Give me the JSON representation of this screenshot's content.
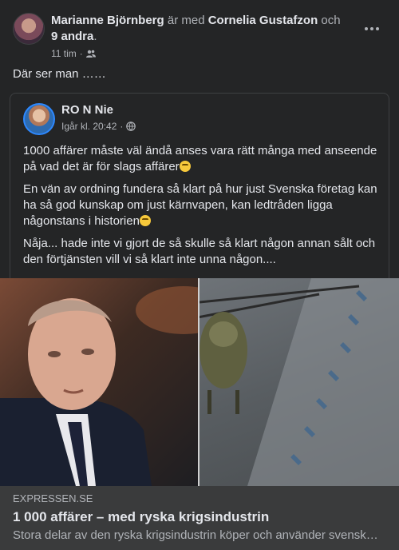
{
  "post": {
    "author": "Marianne Björnberg",
    "with_text": "är med",
    "tagged": "Cornelia Gustafzon",
    "and_text": "och",
    "others": "9 andra",
    "period": ".",
    "time": "11 tim",
    "dot": "·",
    "audience_icon": "friends-icon",
    "caption": "Där ser man ……"
  },
  "shared": {
    "author": "RO N Nie",
    "time": "Igår kl. 20:42",
    "dot": "·",
    "audience_icon": "globe-icon",
    "paragraphs": [
      "1000 affärer måste väl ändå anses vara rätt många med anseende på vad det är för slags affärer",
      "En vän av ordning fundera så klart på hur just Svenska företag kan ha så god kunskap om just kärnvapen, kan ledtråden ligga någonstans i historien",
      "Nåja... hade inte vi gjort de så skulle så klart någon annan sålt och den förtjänsten vill vi så klart inte unna någon...."
    ]
  },
  "link": {
    "domain": "EXPRESSEN.SE",
    "title": "1 000 affärer – med ryska krigsindustrin",
    "description": "Stora delar av den ryska krigsindustrin köper och använder svensk…"
  }
}
